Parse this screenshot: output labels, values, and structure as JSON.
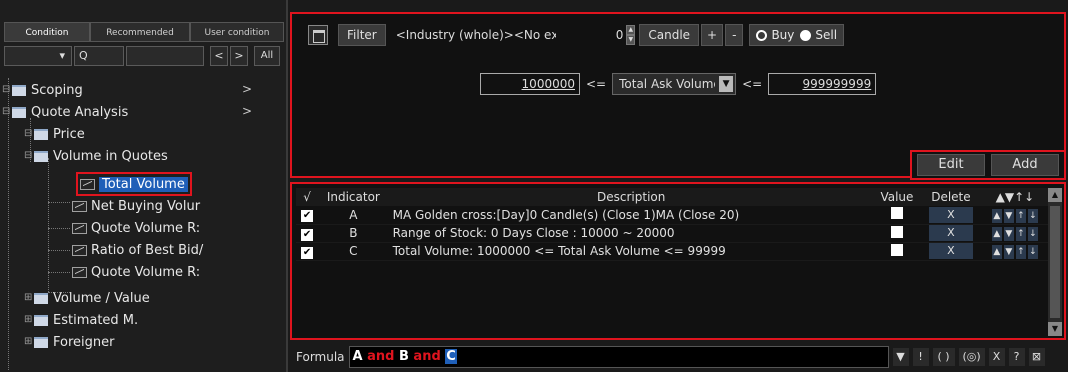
{
  "left_panel": {
    "tabs": [
      {
        "label": "Condition",
        "active": true
      },
      {
        "label": "Recommended",
        "active": false
      },
      {
        "label": "User condition",
        "active": false
      }
    ],
    "toolbar": {
      "dropdown_arrow": "▾",
      "search_icon": "Q",
      "prev": "<",
      "next": ">",
      "all": "All"
    },
    "tree": [
      {
        "label": "Scoping",
        "has_arrow": true,
        "arrow": ">"
      },
      {
        "label": "Quote Analysis",
        "has_arrow": true,
        "arrow": ">"
      },
      {
        "label": "Price"
      },
      {
        "label": "Volume in Quotes"
      },
      {
        "label": "Total Volume",
        "selected": true
      },
      {
        "label": "Net Buying Volur"
      },
      {
        "label": "Quote Volume R:"
      },
      {
        "label": "Ratio of Best Bid/"
      },
      {
        "label": "Quote Volume R:"
      },
      {
        "label": "Volume / Value"
      },
      {
        "label": "Estimated M."
      },
      {
        "label": "Foreigner"
      }
    ]
  },
  "filter_bar": {
    "filter_label": "Filter",
    "filter_text": "<Industry (whole)><No exclusion><Monthly s",
    "count": "0",
    "candle_label": "Candle",
    "plus": "+",
    "minus": "-",
    "buy_label": "Buy",
    "sell_label": "Sell",
    "selected": "Sell"
  },
  "condition": {
    "min_value": "1000000",
    "op1": "<=",
    "indicator": "Total Ask Volume",
    "op2": "<=",
    "max_value": "999999999"
  },
  "actions": {
    "edit_label": "Edit",
    "add_label": "Add"
  },
  "table": {
    "headers": {
      "check": "√",
      "indicator": "Indicator",
      "description": "Description",
      "value": "Value",
      "delete": "Delete",
      "order": "▲▼↑↓"
    },
    "rows": [
      {
        "check": "✔",
        "indicator": "A",
        "description": "MA Golden cross:[Day]0 Candle(s) (Close 1)MA (Close 20)",
        "delete": "X"
      },
      {
        "check": "✔",
        "indicator": "B",
        "description": "Range of Stock: 0 Days Close : 10000 ~ 20000",
        "delete": "X"
      },
      {
        "check": "✔",
        "indicator": "C",
        "description": "Total Volume: 1000000 <= Total Ask Volume <= 99999",
        "delete": "X"
      }
    ],
    "row_arrows": [
      "▲",
      "▼",
      "↑",
      "↓"
    ]
  },
  "formula": {
    "label": "Formula",
    "tokens": [
      {
        "text": "A",
        "kind": "var"
      },
      {
        "text": " and ",
        "kind": "kw"
      },
      {
        "text": "B",
        "kind": "var"
      },
      {
        "text": " and ",
        "kind": "kw"
      },
      {
        "text": "C",
        "kind": "cursor"
      }
    ],
    "buttons": [
      "▼",
      "!",
      "( )",
      "(◎)",
      "X",
      "?",
      "⊠"
    ]
  }
}
